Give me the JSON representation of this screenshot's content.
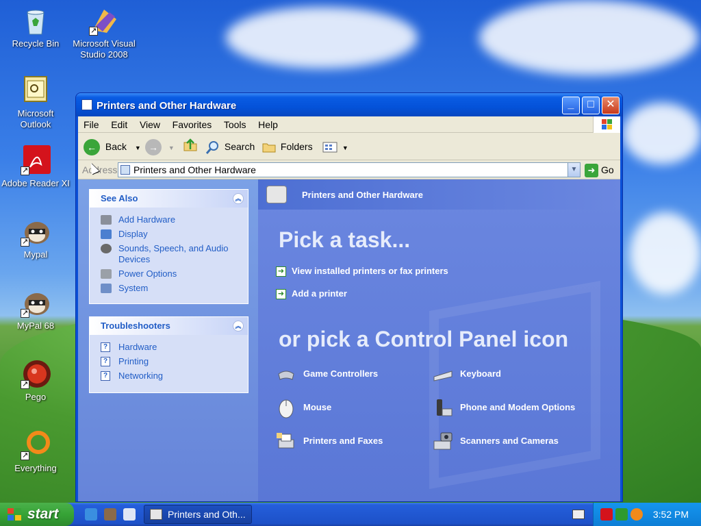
{
  "desktop": {
    "icons": [
      {
        "label": "Recycle Bin",
        "icon": "recycle-bin-icon"
      },
      {
        "label": "Microsoft Visual Studio 2008",
        "icon": "visual-studio-icon"
      },
      {
        "label": "Microsoft Outlook",
        "icon": "outlook-icon"
      },
      {
        "label": "Adobe Reader XI",
        "icon": "adobe-reader-icon"
      },
      {
        "label": "Mypal",
        "icon": "mypal-icon"
      },
      {
        "label": "MyPal 68",
        "icon": "mypal68-icon"
      },
      {
        "label": "Pego",
        "icon": "pego-icon"
      },
      {
        "label": "Everything",
        "icon": "everything-icon"
      }
    ]
  },
  "window": {
    "title": "Printers and Other Hardware",
    "menu": [
      "File",
      "Edit",
      "View",
      "Favorites",
      "Tools",
      "Help"
    ],
    "toolbar": {
      "back": "Back",
      "search": "Search",
      "folders": "Folders"
    },
    "address": {
      "label": "Address",
      "value": "Printers and Other Hardware",
      "go": "Go"
    }
  },
  "see_also": {
    "title": "See Also",
    "items": [
      "Add Hardware",
      "Display",
      "Sounds, Speech, and Audio Devices",
      "Power Options",
      "System"
    ]
  },
  "troubleshooters": {
    "title": "Troubleshooters",
    "items": [
      "Hardware",
      "Printing",
      "Networking"
    ]
  },
  "content": {
    "header": "Printers and Other Hardware",
    "pick_task": "Pick a task...",
    "tasks": [
      "View installed printers or fax printers",
      "Add a printer"
    ],
    "pick_icon": "or pick a Control Panel icon",
    "icons": [
      {
        "label": "Game Controllers",
        "icon": "gamepad-icon"
      },
      {
        "label": "Keyboard",
        "icon": "keyboard-icon"
      },
      {
        "label": "Mouse",
        "icon": "mouse-icon"
      },
      {
        "label": "Phone and Modem Options",
        "icon": "phone-modem-icon"
      },
      {
        "label": "Printers and Faxes",
        "icon": "printer-icon"
      },
      {
        "label": "Scanners and Cameras",
        "icon": "scanner-camera-icon"
      }
    ]
  },
  "taskbar": {
    "start": "start",
    "task_button": "Printers and Oth...",
    "clock": "3:52 PM"
  },
  "colors": {
    "link": "#215dc6",
    "title_bar": "#0452d9",
    "content_bg": "#6b87e0",
    "taskbar": "#245edb",
    "start": "#36a336"
  }
}
